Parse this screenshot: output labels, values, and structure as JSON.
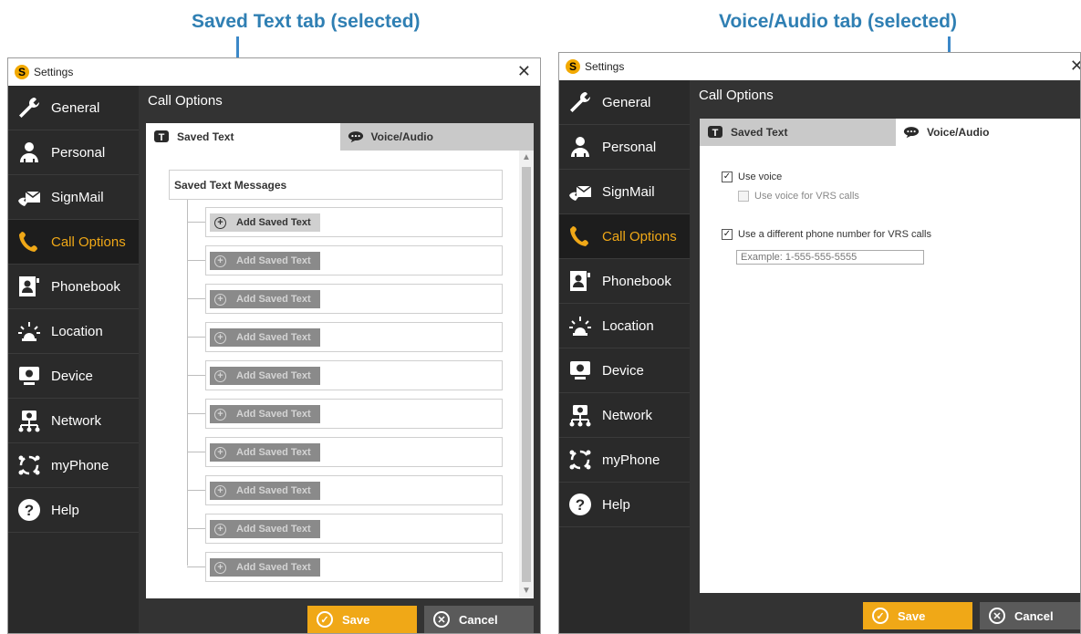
{
  "callouts": {
    "left": "Saved Text tab (selected)",
    "right": "Voice/Audio tab (selected)"
  },
  "window": {
    "title": "Settings",
    "close_glyph": "✕",
    "logo_glyph": "S"
  },
  "sidebar": {
    "items": [
      {
        "label": "General",
        "icon": "wrench-icon"
      },
      {
        "label": "Personal",
        "icon": "person-icon"
      },
      {
        "label": "SignMail",
        "icon": "signmail-icon"
      },
      {
        "label": "Call Options",
        "icon": "call-options-icon"
      },
      {
        "label": "Phonebook",
        "icon": "phonebook-icon"
      },
      {
        "label": "Location",
        "icon": "location-icon"
      },
      {
        "label": "Device",
        "icon": "device-icon"
      },
      {
        "label": "Network",
        "icon": "network-icon"
      },
      {
        "label": "myPhone",
        "icon": "myphone-icon"
      },
      {
        "label": "Help",
        "icon": "help-icon"
      }
    ],
    "active_index": 3
  },
  "content": {
    "title": "Call Options",
    "tabs": [
      {
        "label": "Saved Text",
        "icon_glyph": "T"
      },
      {
        "label": "Voice/Audio"
      }
    ]
  },
  "saved_text": {
    "header": "Saved Text Messages",
    "add_label": "Add Saved Text",
    "plus_glyph": "+",
    "row_count": 10
  },
  "voice_audio": {
    "use_voice": {
      "label": "Use voice",
      "checked": true
    },
    "use_voice_vrs": {
      "label": "Use voice for VRS calls",
      "checked": false,
      "enabled": false
    },
    "different_number": {
      "label": "Use a different phone number for VRS calls",
      "checked": true
    },
    "phone_placeholder": "Example: 1-555-555-5555",
    "check_glyph": "✓"
  },
  "buttons": {
    "save": "Save",
    "cancel": "Cancel",
    "save_glyph": "✓",
    "cancel_glyph": "✕"
  },
  "scroll": {
    "up_glyph": "▲",
    "down_glyph": "▼"
  },
  "colors": {
    "accent": "#f0a817",
    "callout": "#2f7fb3",
    "sidebar_bg": "#2a2a2a",
    "content_bg": "#333333"
  }
}
